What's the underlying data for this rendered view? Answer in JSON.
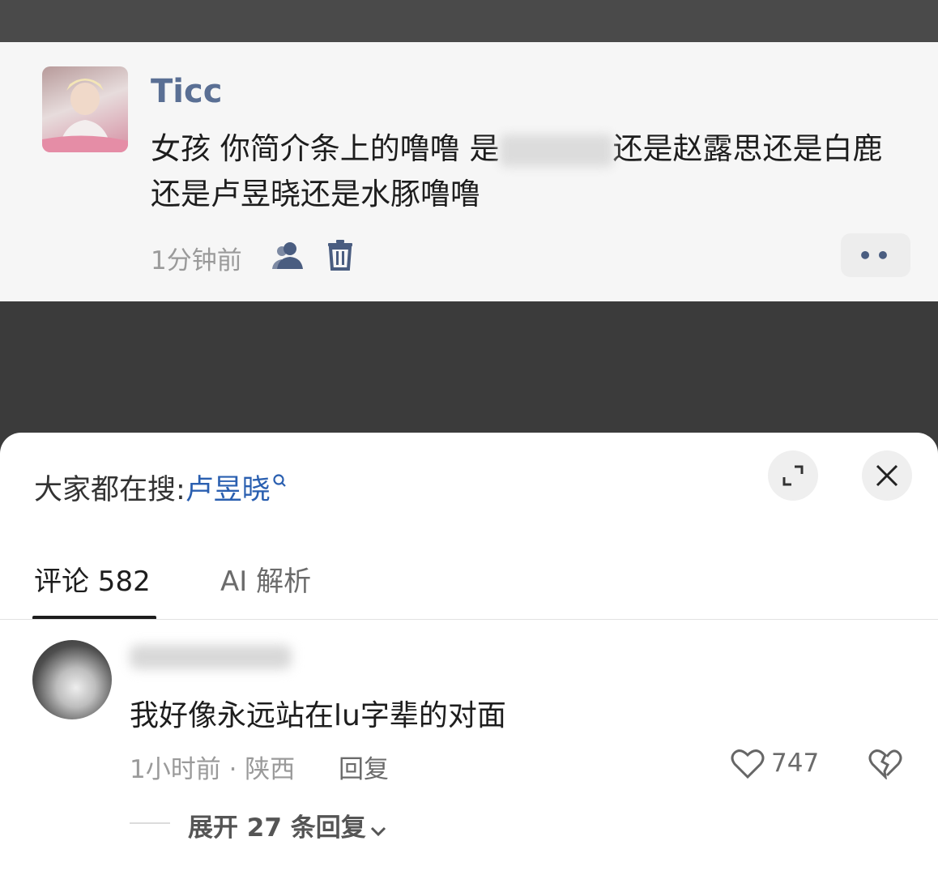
{
  "post": {
    "author": "Ticc",
    "text_before": "女孩 你简介条上的噜噜 是",
    "text_blurred": "",
    "text_after": "还是赵露思还是白鹿还是卢昱晓还是水豚噜噜",
    "time": "1分钟前",
    "more_label": "••"
  },
  "sheet": {
    "search_prefix": "大家都在搜:",
    "search_term": "卢昱晓",
    "tabs": [
      {
        "label": "评论 582"
      },
      {
        "label": "AI 解析"
      }
    ]
  },
  "comment": {
    "text": "我好像永远站在lu字辈的对面",
    "meta": "1小时前 · 陕西",
    "reply_label": "回复",
    "likes": "747",
    "expand_label": "展开 27 条回复"
  },
  "colors": {
    "author": "#5a6f94",
    "search_term": "#2a5fb0",
    "background_dim": "#3b3b3b"
  }
}
